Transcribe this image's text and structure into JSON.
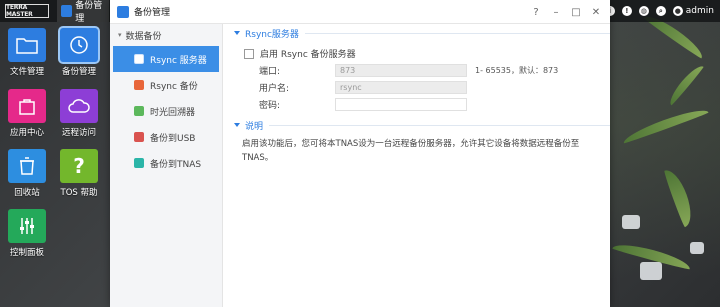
{
  "topbar": {
    "brand": "TERRA MASTER",
    "active_task": "备份管理",
    "user": "admin"
  },
  "desktop_icons": [
    {
      "label": "文件管理",
      "icon": "folder-icon",
      "color": "#2d7de0"
    },
    {
      "label": "备份管理",
      "icon": "clock-icon",
      "color": "#2d7de0"
    },
    {
      "label": "应用中心",
      "icon": "shopping-bag-icon",
      "color": "#e5298a"
    },
    {
      "label": "远程访问",
      "icon": "cloud-icon",
      "color": "#8d3ed6"
    },
    {
      "label": "回收站",
      "icon": "trash-icon",
      "color": "#2d8ee0"
    },
    {
      "label": "TOS 帮助",
      "icon": "question-icon",
      "color": "#73b72c"
    },
    {
      "label": "控制面板",
      "icon": "sliders-icon",
      "color": "#24a95a"
    }
  ],
  "window": {
    "title": "备份管理",
    "controls": [
      "?",
      "–",
      "□",
      "✕"
    ]
  },
  "sidebar": {
    "group": "数据备份",
    "items": [
      {
        "label": "Rsync 服务器",
        "icon": "server-icon",
        "active": true
      },
      {
        "label": "Rsync 备份",
        "icon": "sync-icon",
        "active": false
      },
      {
        "label": "时光回溯器",
        "icon": "time-machine-icon",
        "active": false
      },
      {
        "label": "备份到USB",
        "icon": "usb-icon",
        "active": false
      },
      {
        "label": "备份到TNAS",
        "icon": "nas-icon",
        "active": false
      }
    ]
  },
  "rsync_section": {
    "heading": "Rsync服务器",
    "enable_label": "启用 Rsync 备份服务器",
    "port_label": "端口:",
    "port_value": "873",
    "port_hint": "1- 65535，默认：873",
    "username_label": "用户名:",
    "username_value": "rsync",
    "password_label": "密码:",
    "password_value": ""
  },
  "desc_section": {
    "heading": "说明",
    "text": "启用该功能后，您可将本TNAS设为一台远程备份服务器，允许其它设备将数据远程备份至TNAS。"
  }
}
